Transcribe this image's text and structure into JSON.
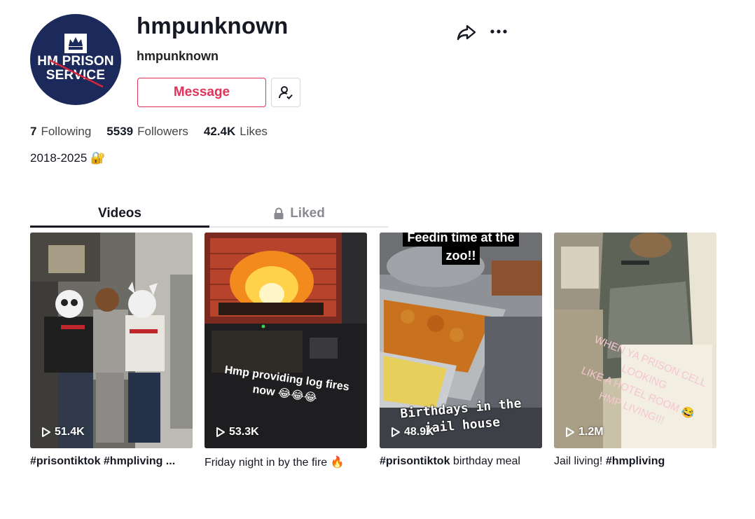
{
  "profile": {
    "avatar_text_line1": "HM PRISON",
    "avatar_text_line2": "SERVICE",
    "username": "hmpunknown",
    "nickname": "hmpunknown",
    "message_label": "Message",
    "bio": "2018-2025 🔐"
  },
  "stats": [
    {
      "value": "7",
      "label": "Following"
    },
    {
      "value": "5539",
      "label": "Followers"
    },
    {
      "value": "42.4K",
      "label": "Likes"
    }
  ],
  "tabs": {
    "videos": "Videos",
    "liked": "Liked"
  },
  "videos": [
    {
      "views": "51.4K",
      "caption_tags": "#prisontiktok #hmpliving ...",
      "caption_text": ""
    },
    {
      "views": "53.3K",
      "overlay_line1": "Hmp providing log fires",
      "overlay_line2": "now 😂😂😂",
      "caption_tags": "",
      "caption_text": "Friday night in by the fire 🔥"
    },
    {
      "views": "48.9K",
      "overlay_top_line1": "Feedin time at the",
      "overlay_top_line2": "zoo!!",
      "overlay_bottom_line1": "Birthdays in the",
      "overlay_bottom_line2": "jail house",
      "caption_tags": "#prisontiktok",
      "caption_text": " birthday meal"
    },
    {
      "views": "1.2M",
      "overlay_line1": "WHEN YA PRISON CELL LOOKING",
      "overlay_line2": "LIKE A HOTEL ROOM 😂",
      "overlay_line3": "HMP LIVING!!!",
      "caption_tags": "#hmpliving",
      "caption_text": "Jail living! "
    }
  ],
  "colors": {
    "accent": "#e0335a",
    "avatar_bg": "#1b2a5a",
    "text": "#161823",
    "muted": "#8a8b91"
  }
}
